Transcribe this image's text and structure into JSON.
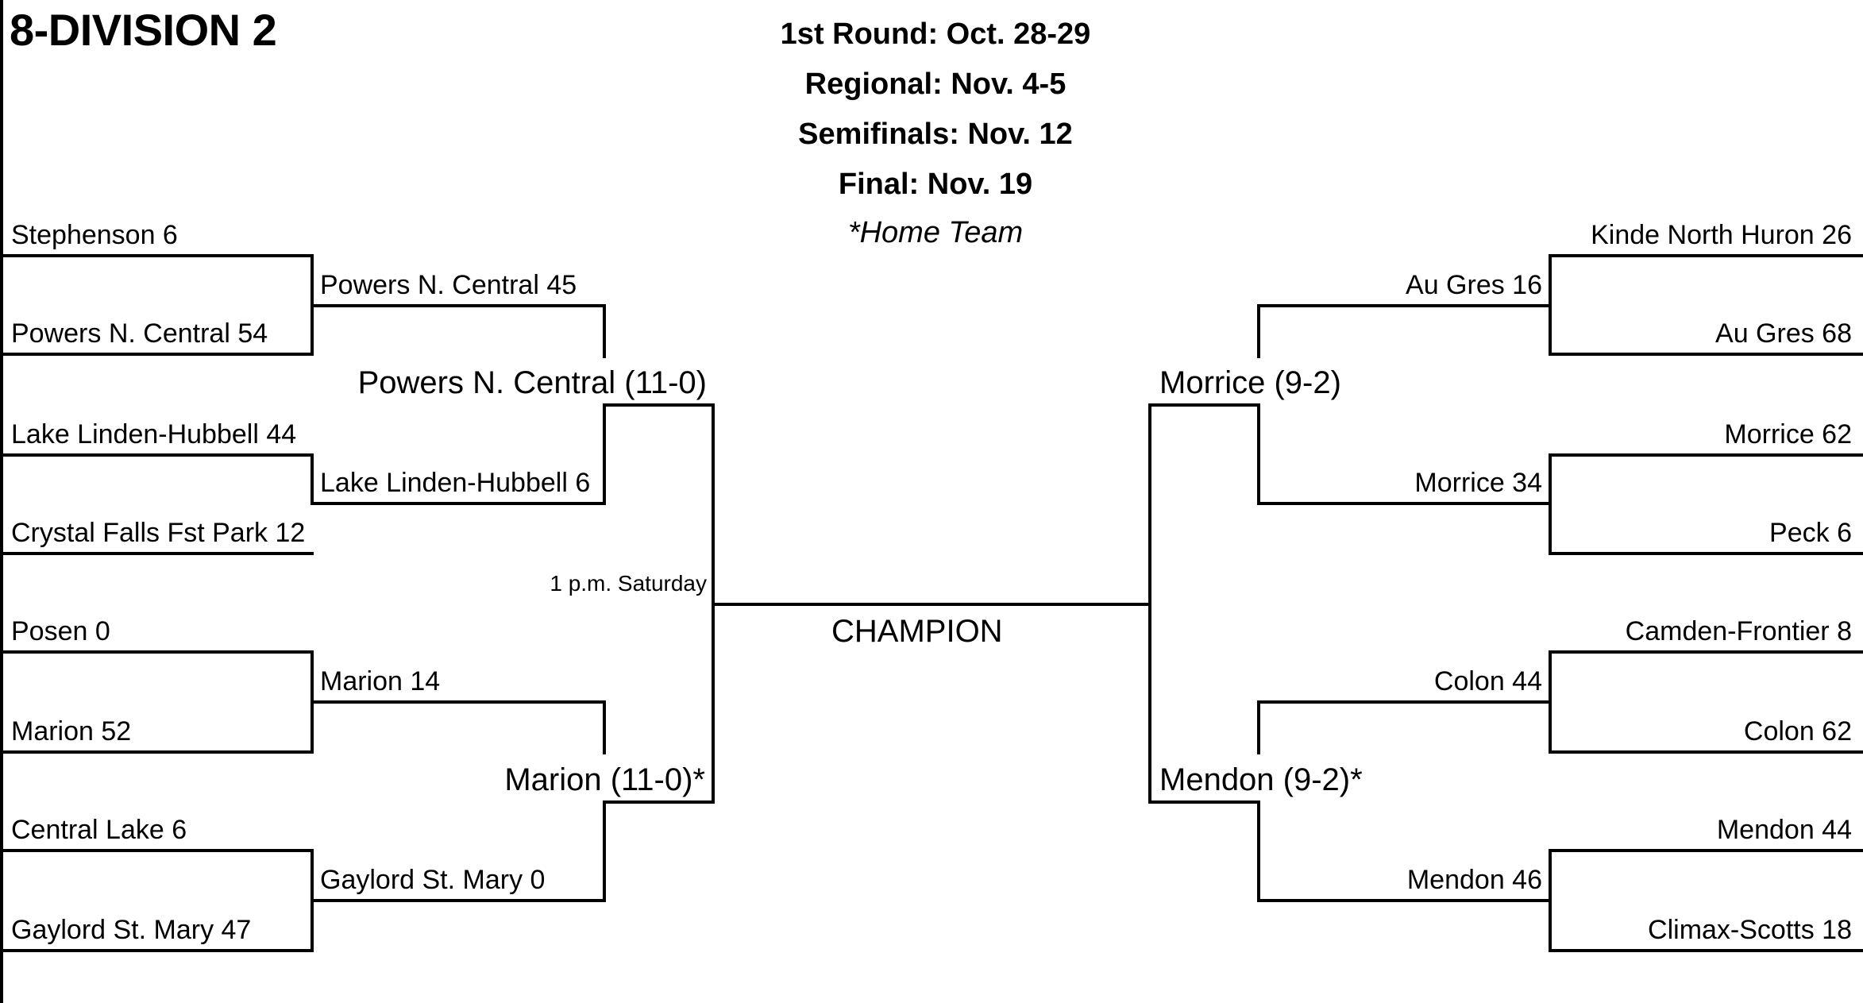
{
  "title": "8-DIVISION 2",
  "schedule": {
    "first_round": "1st Round: Oct. 28-29",
    "regional": "Regional: Nov. 4-5",
    "semifinals": "Semifinals: Nov. 12",
    "final": "Final: Nov. 19",
    "home_note": "*Home Team"
  },
  "left": {
    "first_round": [
      "Stephenson 6",
      "Powers N. Central 54",
      "Lake Linden-Hubbell 44",
      "Crystal Falls Fst Park 12",
      "Posen 0",
      "Marion 52",
      "Central Lake 6",
      "Gaylord St. Mary 47"
    ],
    "regional": [
      "Powers N. Central 45",
      "Lake Linden-Hubbell 6",
      "Marion 14",
      "Gaylord St. Mary 0"
    ],
    "semifinal": [
      "Powers N. Central (11-0)",
      "Marion (11-0)*"
    ],
    "game_note": "1 p.m. Saturday"
  },
  "right": {
    "first_round": [
      "Kinde North Huron 26",
      "Au Gres 68",
      "Morrice 62",
      "Peck 6",
      "Camden-Frontier 8",
      "Colon 62",
      "Mendon 44",
      "Climax-Scotts 18"
    ],
    "regional": [
      "Au Gres 16",
      "Morrice 34",
      "Colon 44",
      "Mendon 46"
    ],
    "semifinal": [
      "Morrice (9-2)",
      "Mendon (9-2)*"
    ]
  },
  "champion_label": "CHAMPION"
}
